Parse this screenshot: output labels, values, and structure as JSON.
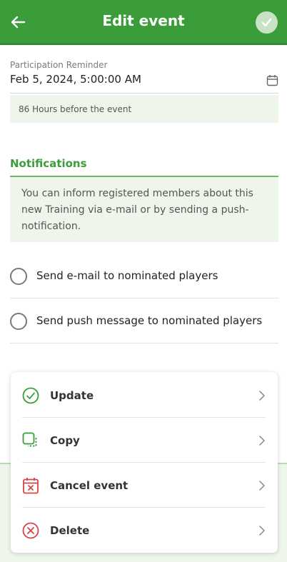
{
  "header": {
    "title": "Edit event",
    "colors": {
      "background": "#3a9d3a",
      "save_button": "#c8e3c3"
    }
  },
  "reminder": {
    "label": "Participation Reminder",
    "value": "Feb 5, 2024, 5:00:00 AM",
    "hours_text": "86 Hours before the event"
  },
  "notifications": {
    "title": "Notifications",
    "info": "You can inform registered members about this new Training via e-mail or by sending a push-notification.",
    "options": [
      {
        "label": "Send e-mail to nominated players",
        "checked": false
      },
      {
        "label": "Send push message to nominated players",
        "checked": false
      }
    ]
  },
  "actions": [
    {
      "label": "Update",
      "icon": "check-circle-icon",
      "color": "#3a9d3a"
    },
    {
      "label": "Copy",
      "icon": "copy-icon",
      "color": "#3a9d3a"
    },
    {
      "label": "Cancel event",
      "icon": "calendar-x-icon",
      "color": "#d64545"
    },
    {
      "label": "Delete",
      "icon": "x-circle-icon",
      "color": "#d64545"
    }
  ]
}
